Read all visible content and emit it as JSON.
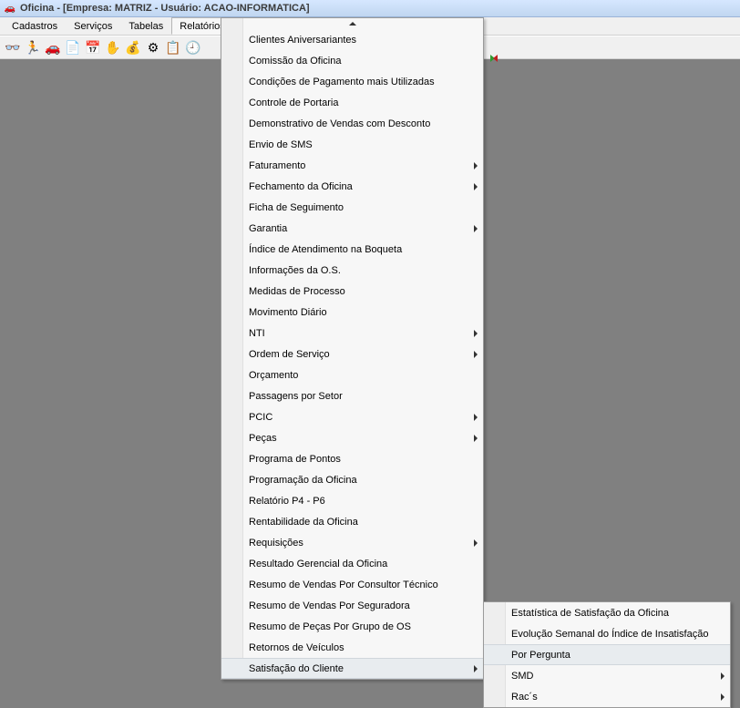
{
  "titlebar": {
    "text": "Oficina - [Empresa: MATRIZ - Usuário: ACAO-INFORMATICA]"
  },
  "menubar": {
    "items": [
      {
        "label": "Cadastros",
        "open": false
      },
      {
        "label": "Serviços",
        "open": false
      },
      {
        "label": "Tabelas",
        "open": false
      },
      {
        "label": "Relatórios",
        "open": true
      }
    ]
  },
  "toolbar": {
    "buttons": [
      {
        "name": "glasses-icon",
        "glyph": "👓"
      },
      {
        "name": "exit-icon",
        "glyph": "🏃"
      },
      {
        "name": "car-icon",
        "glyph": "🚗"
      },
      {
        "name": "doc-icon",
        "glyph": "📄"
      },
      {
        "name": "calendar-icon",
        "glyph": "📅"
      },
      {
        "name": "hand-icon",
        "glyph": "✋"
      },
      {
        "name": "money-icon",
        "glyph": "💰"
      },
      {
        "name": "tire-icon",
        "glyph": "⚙"
      },
      {
        "name": "form-icon",
        "glyph": "📋"
      },
      {
        "name": "clock-icon",
        "glyph": "🕘"
      }
    ]
  },
  "menu_main": {
    "items": [
      {
        "label": "Clientes Aniversariantes",
        "submenu": false
      },
      {
        "label": "Comissão da Oficina",
        "submenu": false
      },
      {
        "label": "Condições de Pagamento mais Utilizadas",
        "submenu": false
      },
      {
        "label": "Controle de Portaria",
        "submenu": false
      },
      {
        "label": "Demonstrativo de Vendas com Desconto",
        "submenu": false
      },
      {
        "label": "Envio de SMS",
        "submenu": false
      },
      {
        "label": "Faturamento",
        "submenu": true
      },
      {
        "label": "Fechamento da Oficina",
        "submenu": true
      },
      {
        "label": "Ficha de Seguimento",
        "submenu": false
      },
      {
        "label": "Garantia",
        "submenu": true
      },
      {
        "label": "Índice de Atendimento na Boqueta",
        "submenu": false
      },
      {
        "label": "Informações da O.S.",
        "submenu": false
      },
      {
        "label": "Medidas de Processo",
        "submenu": false
      },
      {
        "label": "Movimento Diário",
        "submenu": false
      },
      {
        "label": "NTI",
        "submenu": true
      },
      {
        "label": "Ordem de Serviço",
        "submenu": true
      },
      {
        "label": "Orçamento",
        "submenu": false
      },
      {
        "label": "Passagens por Setor",
        "submenu": false
      },
      {
        "label": "PCIC",
        "submenu": true
      },
      {
        "label": "Peças",
        "submenu": true
      },
      {
        "label": "Programa de Pontos",
        "submenu": false
      },
      {
        "label": "Programação da Oficina",
        "submenu": false
      },
      {
        "label": "Relatório P4 - P6",
        "submenu": false
      },
      {
        "label": "Rentabilidade da Oficina",
        "submenu": false
      },
      {
        "label": "Requisições",
        "submenu": true
      },
      {
        "label": "Resultado Gerencial da Oficina",
        "submenu": false
      },
      {
        "label": "Resumo de Vendas Por Consultor Técnico",
        "submenu": false
      },
      {
        "label": "Resumo de Vendas Por Seguradora",
        "submenu": false
      },
      {
        "label": "Resumo de Peças Por Grupo de OS",
        "submenu": false
      },
      {
        "label": "Retornos de Veículos",
        "submenu": false
      },
      {
        "label": "Satisfação do Cliente",
        "submenu": true,
        "highlight": true
      }
    ]
  },
  "menu_sub": {
    "items": [
      {
        "label": "Estatística de Satisfação da Oficina",
        "submenu": false
      },
      {
        "label": "Evolução Semanal do Índice de Insatisfação",
        "submenu": false
      },
      {
        "label": "Por Pergunta",
        "submenu": false,
        "highlight": true
      },
      {
        "label": "SMD",
        "submenu": true
      },
      {
        "label": "Rac´s",
        "submenu": true
      }
    ]
  }
}
